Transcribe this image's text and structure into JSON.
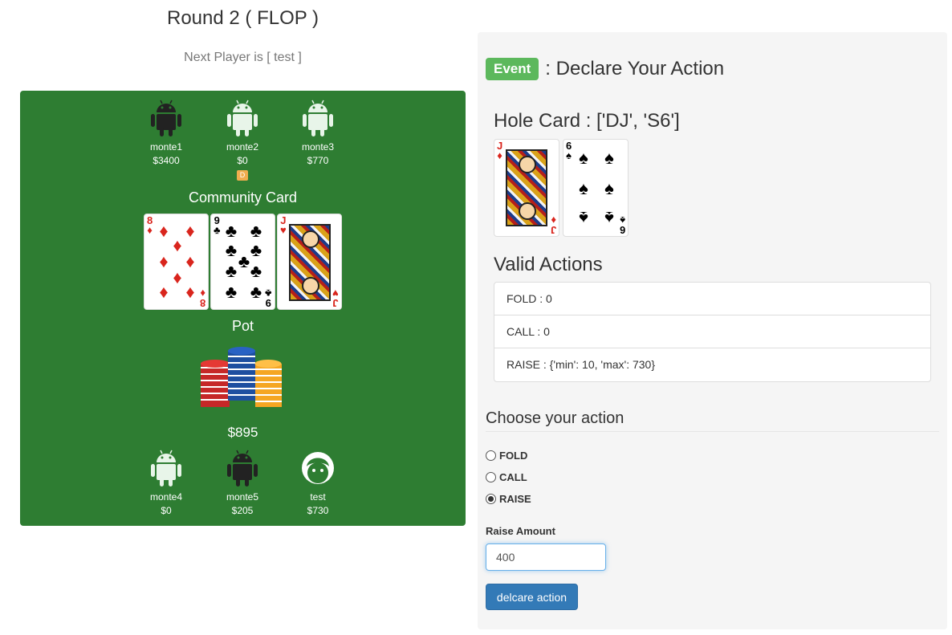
{
  "header": {
    "round_title": "Round 2 ( FLOP )",
    "next_player": "Next Player is [ test ]"
  },
  "table": {
    "top_seats": [
      {
        "name": "monte1",
        "stack": "$3400",
        "icon": "android-icon",
        "color": "#222222"
      },
      {
        "name": "monte2",
        "stack": "$0",
        "icon": "android-icon",
        "color": "#e8f5e9",
        "dealer": "D"
      },
      {
        "name": "monte3",
        "stack": "$770",
        "icon": "android-icon",
        "color": "#e8f5e9"
      }
    ],
    "bottom_seats": [
      {
        "name": "monte4",
        "stack": "$0",
        "icon": "android-icon",
        "color": "#e8f5e9"
      },
      {
        "name": "monte5",
        "stack": "$205",
        "icon": "android-icon",
        "color": "#222222"
      },
      {
        "name": "test",
        "stack": "$730",
        "icon": "user-face-icon",
        "color": "#ffffff"
      }
    ],
    "community_title": "Community Card",
    "community_cards": [
      {
        "rank": "8",
        "suit": "♦",
        "color": "red"
      },
      {
        "rank": "9",
        "suit": "♣",
        "color": "black"
      },
      {
        "rank": "J",
        "suit": "♥",
        "color": "red"
      }
    ],
    "pot_title": "Pot",
    "pot_amount": "$895",
    "felt_color": "#2e7d32"
  },
  "panel": {
    "event_badge": "Event",
    "event_text": ": Declare Your Action",
    "hole_title": "Hole Card : ['DJ', 'S6']",
    "hole_cards": [
      {
        "rank": "J",
        "suit": "♦",
        "color": "red"
      },
      {
        "rank": "6",
        "suit": "♠",
        "color": "black"
      }
    ],
    "valid_title": "Valid Actions",
    "valid_actions": [
      "FOLD : 0",
      "CALL : 0",
      "RAISE : {'min': 10, 'max': 730}"
    ],
    "choose_title": "Choose your action",
    "options": [
      {
        "label": "FOLD",
        "selected": false
      },
      {
        "label": "CALL",
        "selected": false
      },
      {
        "label": "RAISE",
        "selected": true
      }
    ],
    "raise_label": "Raise Amount",
    "raise_value": "400",
    "submit_label": "delcare action"
  }
}
